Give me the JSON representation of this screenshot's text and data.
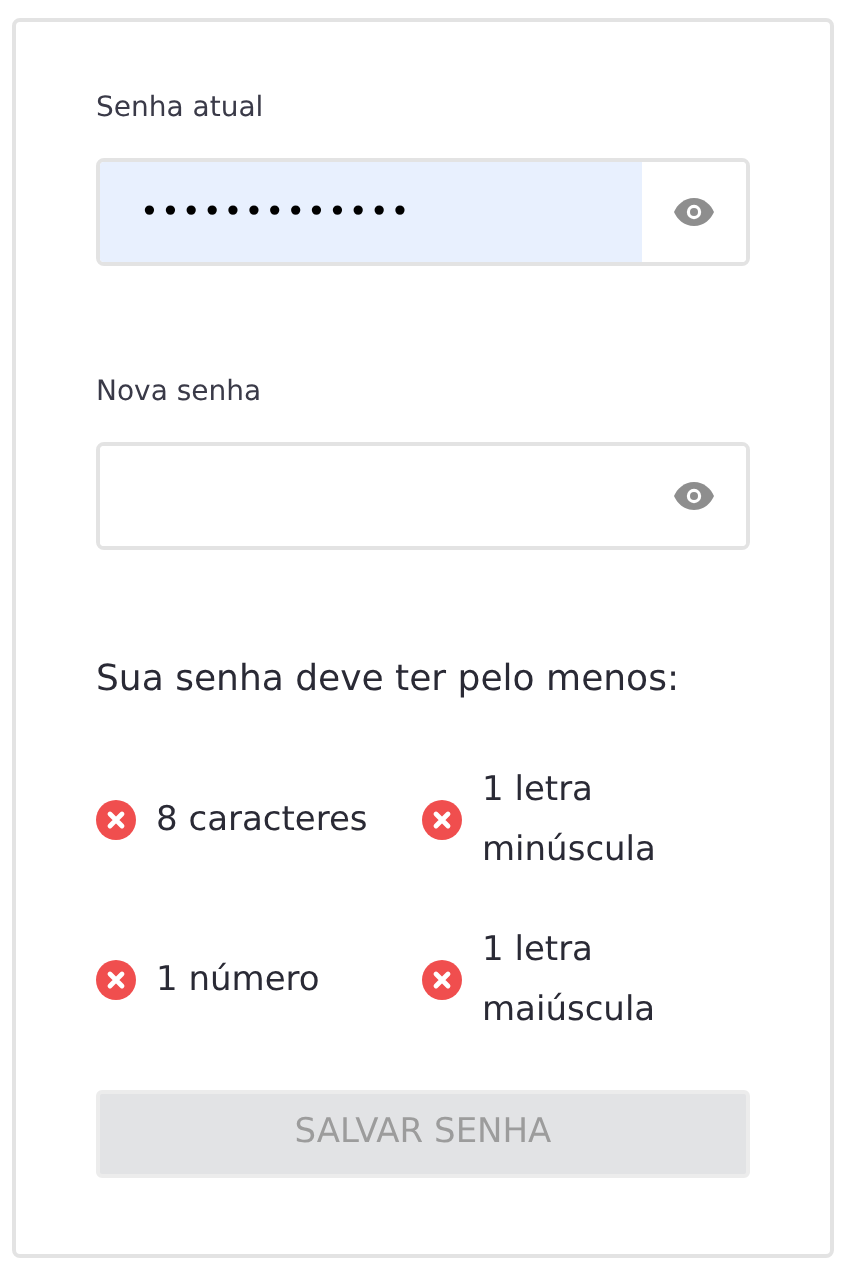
{
  "fields": [
    {
      "label": "Senha atual",
      "value": "•••••••••••••",
      "autofilled": true
    },
    {
      "label": "Nova senha",
      "autofilled": false
    }
  ],
  "requirements_title": "Sua senha deve ter pelo menos:",
  "requirements": [
    {
      "text": "8 caracteres",
      "met": false
    },
    {
      "text": "1 letra minúscula",
      "met": false
    },
    {
      "text": "1 número",
      "met": false
    },
    {
      "text": "1 letra maiúscula",
      "met": false
    }
  ],
  "save_button": {
    "label": "SALVAR SENHA",
    "disabled": true
  }
}
